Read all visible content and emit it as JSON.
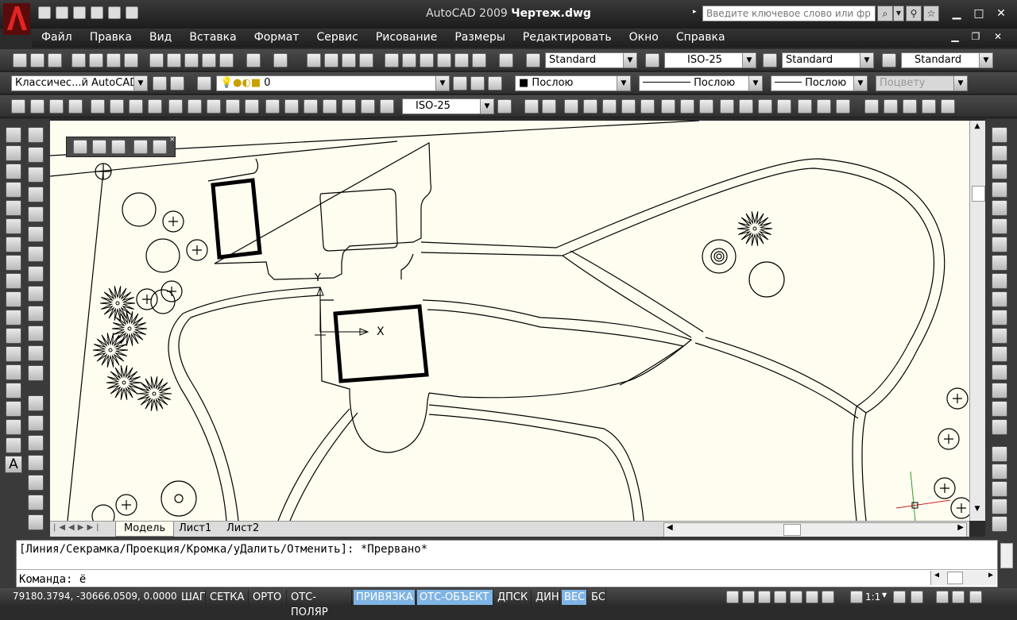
{
  "app": {
    "title_app": "AutoCAD 2009",
    "title_doc": "Чертеж.dwg",
    "search_placeholder": "Введите ключевое слово или фр"
  },
  "menu": [
    "Файл",
    "Правка",
    "Вид",
    "Вставка",
    "Формат",
    "Сервис",
    "Рисование",
    "Размеры",
    "Редактировать",
    "Окно",
    "Справка"
  ],
  "styles_toolbar": {
    "text_style": "Standard",
    "dim_style": "ISO-25",
    "table_style": "Standard",
    "multileader_style": "Standard"
  },
  "layers_toolbar": {
    "workspace": "Классичес...й AutoCAD",
    "layer": "0",
    "color": "Послою",
    "linetype": "Послою",
    "lineweight": "Послою",
    "plotstyle": "Поцвету"
  },
  "dim_toolbar": {
    "dim_style": "ISO-25"
  },
  "layout_tabs": [
    "Модель",
    "Лист1",
    "Лист2"
  ],
  "active_tab": "Модель",
  "command": {
    "history": "[Линия/Секрамка/Проекция/Кромка/уДалить/Отменить]: *Прервано*",
    "prompt": "Команда: ё"
  },
  "status": {
    "coords": "79180.3794, -30666.0509, 0.0000",
    "buttons": [
      {
        "label": "ШАГ",
        "on": false
      },
      {
        "label": "СЕТКА",
        "on": false
      },
      {
        "label": "ОРТО",
        "on": false
      },
      {
        "label": "ОТС-ПОЛЯР",
        "on": false
      },
      {
        "label": "ПРИВЯЗКА",
        "on": true
      },
      {
        "label": "ОТС-ОБЪЕКТ",
        "on": true
      },
      {
        "label": "ДПСК",
        "on": false
      },
      {
        "label": "ДИН",
        "on": false
      },
      {
        "label": "ВЕС",
        "on": true
      },
      {
        "label": "БС",
        "on": false
      }
    ],
    "annotation_scale": "1:1"
  },
  "ucs": {
    "x_label": "X",
    "y_label": "Y"
  },
  "colors": {
    "accent_on": "#7fb4e4",
    "drawing_bg": "#fffdf0"
  }
}
